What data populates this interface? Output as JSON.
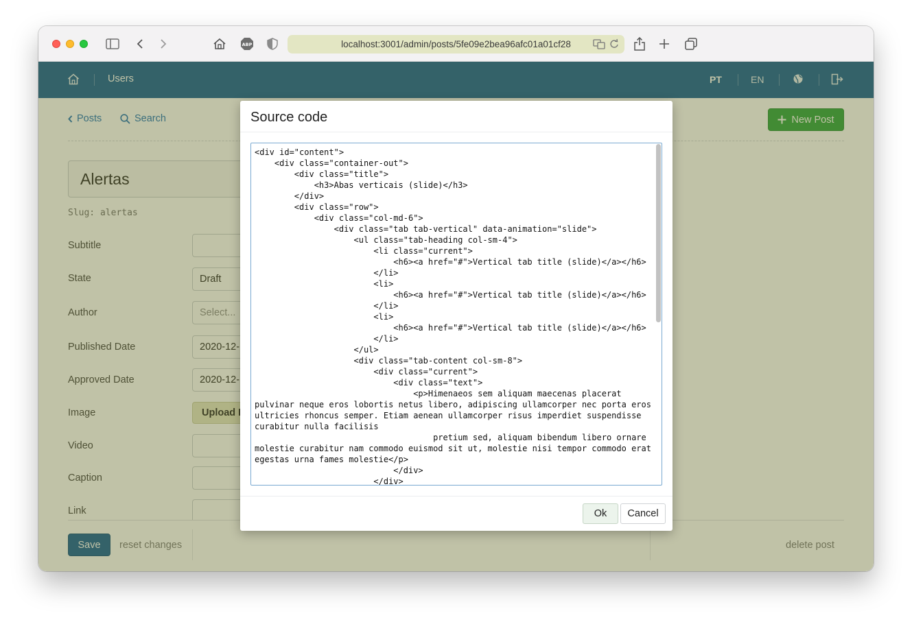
{
  "browser": {
    "url": "localhost:3001/admin/posts/5fe09e2bea96afc01a01cf28",
    "icons": [
      "sidebar-icon",
      "back-icon",
      "forward-icon",
      "home-icon",
      "adblock-icon",
      "shield-icon",
      "translate-icon",
      "reload-icon",
      "share-icon",
      "new-tab-icon",
      "tabs-overview-icon"
    ]
  },
  "navbar": {
    "users_label": "Users",
    "lang_pt": "PT",
    "lang_en": "EN"
  },
  "page": {
    "crumb_posts": "Posts",
    "crumb_search": "Search",
    "new_post_label": "New Post",
    "title_value": "Alertas",
    "slug": "Slug: alertas"
  },
  "form": {
    "subtitle_label": "Subtitle",
    "state_label": "State",
    "state_value": "Draft",
    "author_label": "Author",
    "author_placeholder": "Select...",
    "published_label": "Published Date",
    "published_value": "2020-12-",
    "approved_label": "Approved Date",
    "approved_value": "2020-12-",
    "image_label": "Image",
    "upload_label": "Upload F",
    "video_label": "Video",
    "caption_label": "Caption",
    "link_label": "Link"
  },
  "footer": {
    "save_label": "Save",
    "reset_label": "reset changes",
    "delete_label": "delete post"
  },
  "modal": {
    "title": "Source code",
    "code": "<div id=\"content\">\n    <div class=\"container-out\">\n        <div class=\"title\">\n            <h3>Abas verticais (slide)</h3>\n        </div>\n        <div class=\"row\">\n            <div class=\"col-md-6\">\n                <div class=\"tab tab-vertical\" data-animation=\"slide\">\n                    <ul class=\"tab-heading col-sm-4\">\n                        <li class=\"current\">\n                            <h6><a href=\"#\">Vertical tab title (slide)</a></h6>\n                        </li>\n                        <li>\n                            <h6><a href=\"#\">Vertical tab title (slide)</a></h6>\n                        </li>\n                        <li>\n                            <h6><a href=\"#\">Vertical tab title (slide)</a></h6>\n                        </li>\n                    </ul>\n                    <div class=\"tab-content col-sm-8\">\n                        <div class=\"current\">\n                            <div class=\"text\">\n                                <p>Himenaeos sem aliquam maecenas placerat\npulvinar neque eros lobortis netus libero, adipiscing ullamcorper nec porta eros\nultricies rhoncus semper. Etiam aenean ullamcorper risus imperdiet suspendisse\ncurabitur nulla facilisis\n                                    pretium sed, aliquam bibendum libero ornare\nmolestie curabitur nam commodo euismod sit ut, molestie nisi tempor commodo erat\negestas urna fames molestie</p>\n                            </div>\n                        </div>",
    "ok_label": "Ok",
    "cancel_label": "Cancel"
  },
  "colors": {
    "navbar": "#0e5a95",
    "primary_button": "#0e5a95",
    "success_button": "#26a039",
    "link": "#1a6fb5",
    "overlay": "#686e2e"
  }
}
